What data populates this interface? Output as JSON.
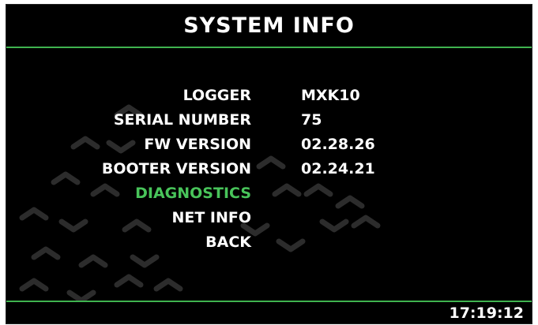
{
  "header": {
    "title": "SYSTEM INFO"
  },
  "menu": {
    "items": [
      {
        "label": "LOGGER",
        "value": "MXK10",
        "selected": false
      },
      {
        "label": "SERIAL NUMBER",
        "value": "75",
        "selected": false
      },
      {
        "label": "FW VERSION",
        "value": "02.28.26",
        "selected": false
      },
      {
        "label": "BOOTER VERSION",
        "value": "02.24.21",
        "selected": false
      },
      {
        "label": "DIAGNOSTICS",
        "value": "",
        "selected": true
      },
      {
        "label": "NET INFO",
        "value": "",
        "selected": false
      },
      {
        "label": "BACK",
        "value": "",
        "selected": false
      }
    ]
  },
  "footer": {
    "time": "17:19:12"
  },
  "colors": {
    "background": "#000000",
    "accent": "#3fb34f",
    "selected_text": "#48c45a",
    "text": "#ffffff",
    "pattern": "#2a2a2a"
  }
}
